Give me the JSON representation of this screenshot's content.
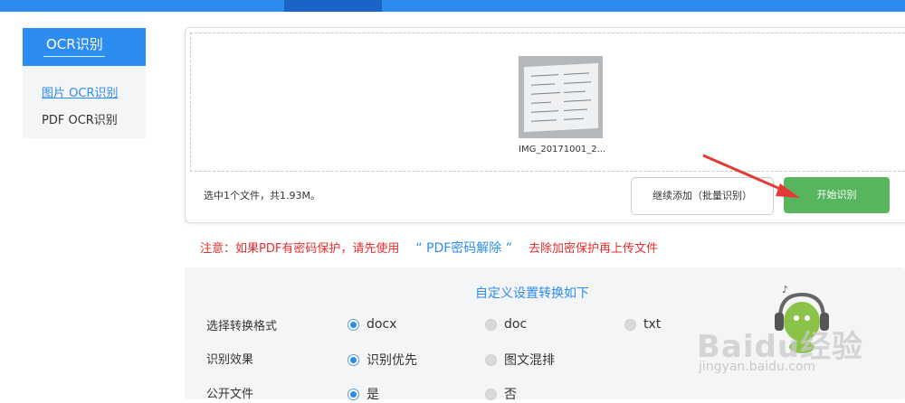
{
  "sidebar": {
    "title": "OCR识别",
    "items": [
      {
        "label": "图片 OCR识别"
      },
      {
        "label": "PDF OCR识别"
      }
    ]
  },
  "upload": {
    "file_name": "IMG_20171001_2...",
    "status": "选中1个文件，共1.93M。",
    "add_button": "继续添加（批量识别）",
    "start_button": "开始识别"
  },
  "notice": {
    "prefix": "注意：如果PDF有密码保护，请先使用",
    "link": "“ PDF密码解除 ”",
    "suffix": "去除加密保护再上传文件"
  },
  "settings": {
    "title": "自定义设置转换如下",
    "rows": [
      {
        "label": "选择转换格式",
        "options": [
          "docx",
          "doc",
          "txt"
        ],
        "selected": "docx"
      },
      {
        "label": "识别效果",
        "options": [
          "识别优先",
          "图文混排"
        ],
        "selected": "识别优先"
      },
      {
        "label": "公开文件",
        "options": [
          "是",
          "否"
        ],
        "selected": "是"
      }
    ]
  },
  "watermark": {
    "brand": "Baidu经验",
    "url": "jingyan.baidu.com"
  },
  "colors": {
    "primary": "#2d8cf0",
    "start_button": "#56b55d",
    "notice": "#e62e2e",
    "arrow": "#e53935"
  }
}
